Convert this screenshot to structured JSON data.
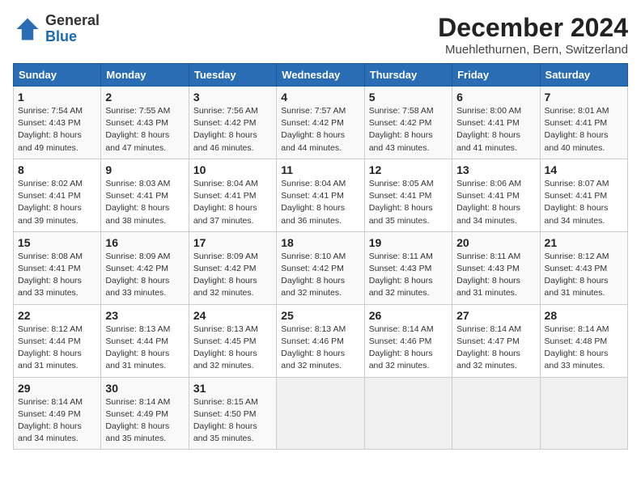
{
  "logo": {
    "general": "General",
    "blue": "Blue"
  },
  "title": "December 2024",
  "subtitle": "Muehlethurnen, Bern, Switzerland",
  "headers": [
    "Sunday",
    "Monday",
    "Tuesday",
    "Wednesday",
    "Thursday",
    "Friday",
    "Saturday"
  ],
  "weeks": [
    [
      {
        "day": "1",
        "sunrise": "7:54 AM",
        "sunset": "4:43 PM",
        "daylight": "8 hours and 49 minutes."
      },
      {
        "day": "2",
        "sunrise": "7:55 AM",
        "sunset": "4:43 PM",
        "daylight": "8 hours and 47 minutes."
      },
      {
        "day": "3",
        "sunrise": "7:56 AM",
        "sunset": "4:42 PM",
        "daylight": "8 hours and 46 minutes."
      },
      {
        "day": "4",
        "sunrise": "7:57 AM",
        "sunset": "4:42 PM",
        "daylight": "8 hours and 44 minutes."
      },
      {
        "day": "5",
        "sunrise": "7:58 AM",
        "sunset": "4:42 PM",
        "daylight": "8 hours and 43 minutes."
      },
      {
        "day": "6",
        "sunrise": "8:00 AM",
        "sunset": "4:41 PM",
        "daylight": "8 hours and 41 minutes."
      },
      {
        "day": "7",
        "sunrise": "8:01 AM",
        "sunset": "4:41 PM",
        "daylight": "8 hours and 40 minutes."
      }
    ],
    [
      {
        "day": "8",
        "sunrise": "8:02 AM",
        "sunset": "4:41 PM",
        "daylight": "8 hours and 39 minutes."
      },
      {
        "day": "9",
        "sunrise": "8:03 AM",
        "sunset": "4:41 PM",
        "daylight": "8 hours and 38 minutes."
      },
      {
        "day": "10",
        "sunrise": "8:04 AM",
        "sunset": "4:41 PM",
        "daylight": "8 hours and 37 minutes."
      },
      {
        "day": "11",
        "sunrise": "8:04 AM",
        "sunset": "4:41 PM",
        "daylight": "8 hours and 36 minutes."
      },
      {
        "day": "12",
        "sunrise": "8:05 AM",
        "sunset": "4:41 PM",
        "daylight": "8 hours and 35 minutes."
      },
      {
        "day": "13",
        "sunrise": "8:06 AM",
        "sunset": "4:41 PM",
        "daylight": "8 hours and 34 minutes."
      },
      {
        "day": "14",
        "sunrise": "8:07 AM",
        "sunset": "4:41 PM",
        "daylight": "8 hours and 34 minutes."
      }
    ],
    [
      {
        "day": "15",
        "sunrise": "8:08 AM",
        "sunset": "4:41 PM",
        "daylight": "8 hours and 33 minutes."
      },
      {
        "day": "16",
        "sunrise": "8:09 AM",
        "sunset": "4:42 PM",
        "daylight": "8 hours and 33 minutes."
      },
      {
        "day": "17",
        "sunrise": "8:09 AM",
        "sunset": "4:42 PM",
        "daylight": "8 hours and 32 minutes."
      },
      {
        "day": "18",
        "sunrise": "8:10 AM",
        "sunset": "4:42 PM",
        "daylight": "8 hours and 32 minutes."
      },
      {
        "day": "19",
        "sunrise": "8:11 AM",
        "sunset": "4:43 PM",
        "daylight": "8 hours and 32 minutes."
      },
      {
        "day": "20",
        "sunrise": "8:11 AM",
        "sunset": "4:43 PM",
        "daylight": "8 hours and 31 minutes."
      },
      {
        "day": "21",
        "sunrise": "8:12 AM",
        "sunset": "4:43 PM",
        "daylight": "8 hours and 31 minutes."
      }
    ],
    [
      {
        "day": "22",
        "sunrise": "8:12 AM",
        "sunset": "4:44 PM",
        "daylight": "8 hours and 31 minutes."
      },
      {
        "day": "23",
        "sunrise": "8:13 AM",
        "sunset": "4:44 PM",
        "daylight": "8 hours and 31 minutes."
      },
      {
        "day": "24",
        "sunrise": "8:13 AM",
        "sunset": "4:45 PM",
        "daylight": "8 hours and 32 minutes."
      },
      {
        "day": "25",
        "sunrise": "8:13 AM",
        "sunset": "4:46 PM",
        "daylight": "8 hours and 32 minutes."
      },
      {
        "day": "26",
        "sunrise": "8:14 AM",
        "sunset": "4:46 PM",
        "daylight": "8 hours and 32 minutes."
      },
      {
        "day": "27",
        "sunrise": "8:14 AM",
        "sunset": "4:47 PM",
        "daylight": "8 hours and 32 minutes."
      },
      {
        "day": "28",
        "sunrise": "8:14 AM",
        "sunset": "4:48 PM",
        "daylight": "8 hours and 33 minutes."
      }
    ],
    [
      {
        "day": "29",
        "sunrise": "8:14 AM",
        "sunset": "4:49 PM",
        "daylight": "8 hours and 34 minutes."
      },
      {
        "day": "30",
        "sunrise": "8:14 AM",
        "sunset": "4:49 PM",
        "daylight": "8 hours and 35 minutes."
      },
      {
        "day": "31",
        "sunrise": "8:15 AM",
        "sunset": "4:50 PM",
        "daylight": "8 hours and 35 minutes."
      },
      null,
      null,
      null,
      null
    ]
  ]
}
